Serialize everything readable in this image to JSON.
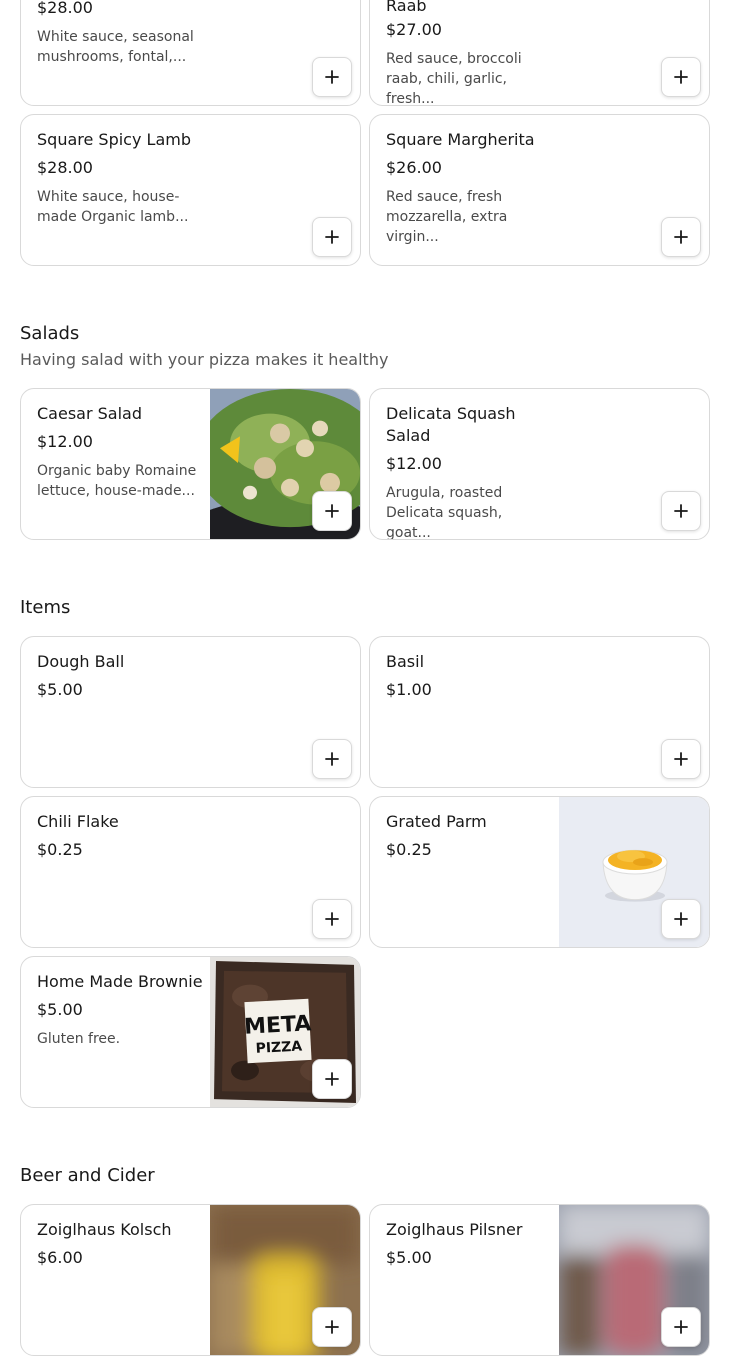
{
  "top_items": [
    {
      "price": "$28.00",
      "desc": "White sauce, seasonal mushrooms, fontal,..."
    },
    {
      "name_tail": "Raab",
      "price": "$27.00",
      "desc": "Red sauce, broccoli raab, chili, garlic, fresh..."
    },
    {
      "name": "Square Spicy Lamb",
      "price": "$28.00",
      "desc": "White sauce, house-made Organic lamb..."
    },
    {
      "name": "Square Margherita",
      "price": "$26.00",
      "desc": "Red sauce, fresh mozzarella, extra virgin..."
    }
  ],
  "salads": {
    "title": "Salads",
    "subtitle": "Having salad with your pizza makes it healthy",
    "items": [
      {
        "name": "Caesar Salad",
        "price": "$12.00",
        "desc": "Organic baby Romaine lettuce, house-made..."
      },
      {
        "name": "Delicata Squash Salad",
        "price": "$12.00",
        "desc": "Arugula, roasted Delicata squash, goat..."
      }
    ]
  },
  "items_section": {
    "title": "Items",
    "items": [
      {
        "name": "Dough Ball",
        "price": "$5.00"
      },
      {
        "name": "Basil",
        "price": "$1.00"
      },
      {
        "name": "Chili Flake",
        "price": "$0.25"
      },
      {
        "name": "Grated Parm",
        "price": "$0.25"
      },
      {
        "name": "Home Made Brownie",
        "price": "$5.00",
        "desc": "Gluten free.",
        "logo_text": "META PIZZA"
      }
    ]
  },
  "beer": {
    "title": "Beer and Cider",
    "items": [
      {
        "name": "Zoiglhaus Kolsch",
        "price": "$6.00"
      },
      {
        "name": "Zoiglhaus Pilsner",
        "price": "$5.00"
      }
    ]
  },
  "icons": {
    "add": "plus-icon"
  },
  "colors": {
    "border": "#d9d9d9",
    "text": "#191919",
    "muted": "#4a4a4a"
  }
}
